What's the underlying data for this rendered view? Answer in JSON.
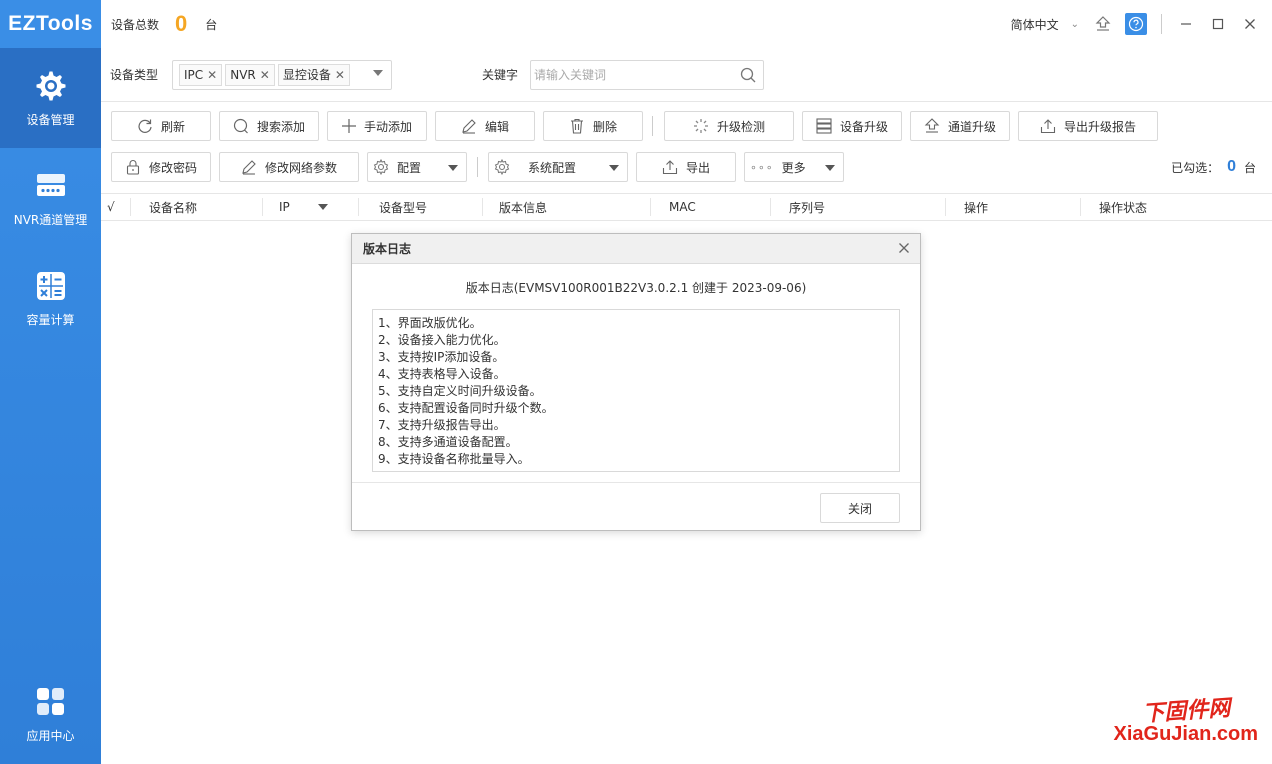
{
  "app": {
    "logo": "EZTools"
  },
  "sidebar": {
    "items": [
      {
        "label": "设备管理",
        "icon": "gear-icon",
        "active": true
      },
      {
        "label": "NVR通道管理",
        "icon": "nvr-device-icon",
        "active": false
      },
      {
        "label": "容量计算",
        "icon": "calculator-icon",
        "active": false
      }
    ],
    "bottom": {
      "label": "应用中心",
      "icon": "app-grid-icon"
    }
  },
  "titlebar": {
    "device_total_label": "设备总数",
    "device_total_value": "0",
    "device_total_unit": "台",
    "language": "简体中文"
  },
  "filter": {
    "device_type_label": "设备类型",
    "tags": [
      "IPC",
      "NVR",
      "显控设备"
    ],
    "keyword_label": "关键字",
    "keyword_placeholder": "请输入关键词",
    "keyword_value": ""
  },
  "toolbar1": {
    "refresh": "刷新",
    "search_add": "搜索添加",
    "manual_add": "手动添加",
    "edit": "编辑",
    "delete": "删除",
    "upgrade_check": "升级检测",
    "device_upgrade": "设备升级",
    "channel_upgrade": "通道升级",
    "export_report": "导出升级报告"
  },
  "toolbar2": {
    "change_password": "修改密码",
    "change_network": "修改网络参数",
    "config": "配置",
    "system_config": "系统配置",
    "export": "导出",
    "more": "更多",
    "selected_label": "已勾选：",
    "selected_count": "0",
    "selected_unit": "台"
  },
  "table": {
    "columns": [
      "√",
      "设备名称",
      "IP",
      "设备型号",
      "版本信息",
      "MAC",
      "序列号",
      "操作",
      "操作状态"
    ],
    "rows": []
  },
  "dialog": {
    "header": "版本日志",
    "title": "版本日志(EVMSV100R001B22V3.0.2.1 创建于 2023-09-06)",
    "lines": [
      "1、界面改版优化。",
      "2、设备接入能力优化。",
      "3、支持按IP添加设备。",
      "4、支持表格导入设备。",
      "5、支持自定义时间升级设备。",
      "6、支持配置设备同时升级个数。",
      "7、支持升级报告导出。",
      "8、支持多通道设备配置。",
      "9、支持设备名称批量导入。"
    ],
    "close_button": "关闭"
  },
  "watermark": {
    "top": "下固件网",
    "bottom": "XiaGuJian.com"
  },
  "colors": {
    "sidebar": "#2f7fd8",
    "count": "#f5a623",
    "accent": "#2f7fd8",
    "watermark": "#e1251b"
  }
}
